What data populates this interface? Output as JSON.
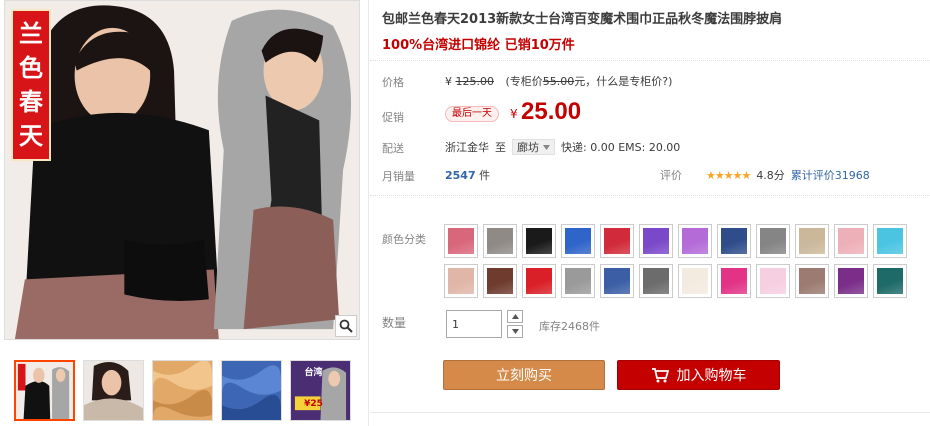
{
  "gallery": {
    "brand_chars": [
      "兰",
      "色",
      "春",
      "天"
    ],
    "thumb3_text": [
      "台湾",
      "¥25"
    ]
  },
  "product": {
    "title": "包邮兰色春天2013新款女士台湾百变魔术围巾正品秋冬魔法围脖披肩",
    "subtitle": "100%台湾进口锦纶 已销10万件"
  },
  "price": {
    "label": "价格",
    "currency": "¥",
    "original": "125.00",
    "counter_prefix": "(专柜价",
    "counter_price": "55.00",
    "counter_suffix": "元，什么是专柜价?)"
  },
  "promo": {
    "label": "促销",
    "tag": "最后一天",
    "currency": "¥",
    "price": "25.00"
  },
  "shipping": {
    "label": "配送",
    "from": "浙江金华",
    "to_word": "至",
    "city": "廊坊",
    "fee": "快递: 0.00 EMS: 20.00"
  },
  "sales": {
    "label": "月销量",
    "count": "2547",
    "unit": "件"
  },
  "rating": {
    "label": "评价",
    "stars": "★★★★★",
    "score": "4.8分",
    "total": "累计评价31968"
  },
  "colors": {
    "label": "颜色分类",
    "swatches": [
      "#d9677c",
      "#8f8a86",
      "#1a1a1a",
      "#2f64c8",
      "#d12a3a",
      "#7a49c9",
      "#b46bd8",
      "#2e4d8a",
      "#858585",
      "#cbb89a",
      "#eeb0b8",
      "#4bc4e2",
      "#e0b6a8",
      "#6e3b2e",
      "#d91f27",
      "#9a9a9a",
      "#3b5ea5",
      "#6c6c6c",
      "#f4ebe0",
      "#e23387",
      "#f6cfe0",
      "#9b7b72",
      "#7a2e89",
      "#1d6a68"
    ]
  },
  "quantity": {
    "label": "数量",
    "value": "1",
    "stock": "库存2468件"
  },
  "actions": {
    "buy_now": "立刻购买",
    "add_cart": "加入购物车"
  }
}
